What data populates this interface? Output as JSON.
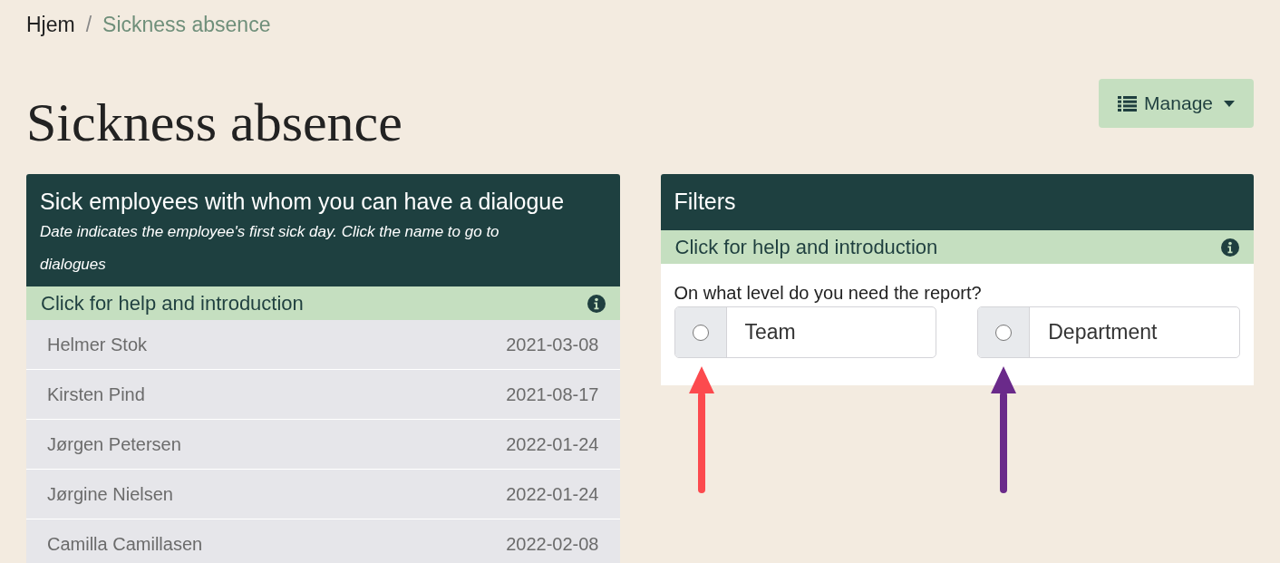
{
  "breadcrumb": {
    "items": [
      "Hjem",
      "Sickness absence"
    ],
    "separator": "/"
  },
  "page_title": "Sickness absence",
  "manage_button": {
    "label": "Manage"
  },
  "employees_panel": {
    "title": "Sick employees with whom you can have a dialogue",
    "subtitle": "Date indicates the employee's first sick day. Click the name to go to dialogues",
    "help": "Click for help and introduction",
    "rows": [
      {
        "name": "Helmer Stok",
        "date": "2021-03-08"
      },
      {
        "name": "Kirsten Pind",
        "date": "2021-08-17"
      },
      {
        "name": "Jørgen Petersen",
        "date": "2022-01-24"
      },
      {
        "name": "Jørgine Nielsen",
        "date": "2022-01-24"
      },
      {
        "name": "Camilla Camillasen",
        "date": "2022-02-08"
      }
    ]
  },
  "filters_panel": {
    "title": "Filters",
    "help": "Click for help and introduction",
    "question": "On what level do you need the report?",
    "options": [
      {
        "label": "Team",
        "selected": false
      },
      {
        "label": "Department",
        "selected": false
      }
    ]
  },
  "annotations": [
    {
      "color": "#fc4a4e"
    },
    {
      "color": "#6a2a8a"
    }
  ]
}
